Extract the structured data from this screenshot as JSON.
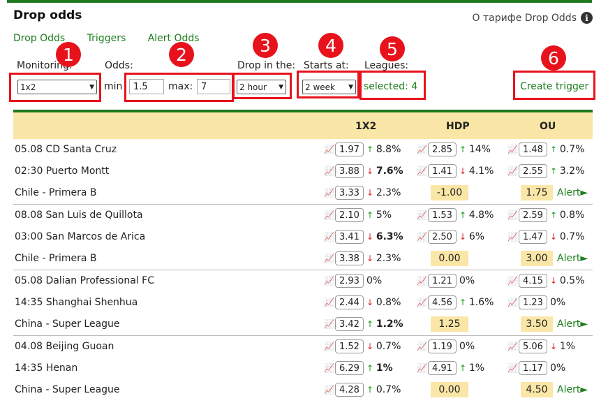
{
  "title": "Drop odds",
  "tariff_link": "О тарифе Drop Odds",
  "nav": [
    "Drop Odds",
    "Triggers",
    "Alert Odds"
  ],
  "filters": {
    "monitoring_label": "Monitoring:",
    "monitoring_value": "1x2",
    "odds_label": "Odds:",
    "min_label": "min",
    "min_value": "1.5",
    "max_label": "max:",
    "max_value": "7",
    "drop_label": "Drop in the:",
    "drop_value": "2 hour",
    "starts_label": "Starts at:",
    "starts_value": "2 week",
    "leagues_label": "Leagues:",
    "leagues_value": "selected: 4",
    "create_trigger": "Create trigger"
  },
  "annotations": [
    "1",
    "2",
    "3",
    "4",
    "5",
    "6"
  ],
  "table": {
    "headers": [
      "1X2",
      "HDP",
      "OU"
    ],
    "matches": [
      {
        "rows": [
          {
            "name": "05.08 CD Santa Cruz",
            "o1": {
              "odd": "1.97",
              "dir": "up",
              "pct": "8.8%",
              "bold": false
            },
            "o2": {
              "odd": "2.85",
              "dir": "up",
              "pct": "14%",
              "bold": false
            },
            "o3": {
              "odd": "1.48",
              "dir": "up",
              "pct": "0.7%",
              "bold": false
            }
          },
          {
            "name": "02:30 Puerto Montt",
            "o1": {
              "odd": "3.88",
              "dir": "down",
              "pct": "7.6%",
              "bold": true
            },
            "o2": {
              "odd": "1.41",
              "dir": "down",
              "pct": "4.1%",
              "bold": false
            },
            "o3": {
              "odd": "2.55",
              "dir": "up",
              "pct": "3.2%",
              "bold": false
            }
          },
          {
            "name": "Chile - Primera B",
            "o1": {
              "odd": "3.33",
              "dir": "down",
              "pct": "2.3%",
              "bold": false
            },
            "hdp_line": "-1.00",
            "ou_line": "1.75",
            "alert": "Alert►"
          }
        ]
      },
      {
        "rows": [
          {
            "name": "08.08 San Luis de Quillota",
            "o1": {
              "odd": "2.10",
              "dir": "up",
              "pct": "5%",
              "bold": false
            },
            "o2": {
              "odd": "1.53",
              "dir": "up",
              "pct": "4.8%",
              "bold": false
            },
            "o3": {
              "odd": "2.59",
              "dir": "up",
              "pct": "0.8%",
              "bold": false
            }
          },
          {
            "name": "03:00 San Marcos de Arica",
            "o1": {
              "odd": "3.41",
              "dir": "down",
              "pct": "6.3%",
              "bold": true
            },
            "o2": {
              "odd": "2.50",
              "dir": "down",
              "pct": "6%",
              "bold": false
            },
            "o3": {
              "odd": "1.47",
              "dir": "down",
              "pct": "0.7%",
              "bold": false
            }
          },
          {
            "name": "Chile - Primera B",
            "o1": {
              "odd": "3.38",
              "dir": "down",
              "pct": "2.3%",
              "bold": false
            },
            "hdp_line": "0.00",
            "ou_line": "3.00",
            "alert": "Alert►"
          }
        ]
      },
      {
        "rows": [
          {
            "name": "05.08 Dalian Professional FC",
            "o1": {
              "odd": "2.93",
              "dir": "",
              "pct": "0%",
              "bold": false
            },
            "o2": {
              "odd": "1.21",
              "dir": "",
              "pct": "0%",
              "bold": false
            },
            "o3": {
              "odd": "4.15",
              "dir": "down",
              "pct": "0.5%",
              "bold": false
            }
          },
          {
            "name": "14:35 Shanghai Shenhua",
            "o1": {
              "odd": "2.44",
              "dir": "down",
              "pct": "0.8%",
              "bold": false
            },
            "o2": {
              "odd": "4.56",
              "dir": "up",
              "pct": "1.6%",
              "bold": false
            },
            "o3": {
              "odd": "1.23",
              "dir": "",
              "pct": "0%",
              "bold": false
            }
          },
          {
            "name": "China - Super League",
            "o1": {
              "odd": "3.42",
              "dir": "up",
              "pct": "1.2%",
              "bold": true
            },
            "hdp_line": "1.25",
            "ou_line": "3.50",
            "alert": "Alert►"
          }
        ]
      },
      {
        "rows": [
          {
            "name": "04.08 Beijing Guoan",
            "o1": {
              "odd": "1.52",
              "dir": "down",
              "pct": "0.7%",
              "bold": false
            },
            "o2": {
              "odd": "1.19",
              "dir": "",
              "pct": "0%",
              "bold": false
            },
            "o3": {
              "odd": "5.06",
              "dir": "down",
              "pct": "1%",
              "bold": false
            }
          },
          {
            "name": "14:35 Henan",
            "o1": {
              "odd": "6.29",
              "dir": "up",
              "pct": "1%",
              "bold": true
            },
            "o2": {
              "odd": "4.91",
              "dir": "up",
              "pct": "1%",
              "bold": false
            },
            "o3": {
              "odd": "1.17",
              "dir": "",
              "pct": "0%",
              "bold": false
            }
          },
          {
            "name": "China - Super League",
            "o1": {
              "odd": "4.28",
              "dir": "up",
              "pct": "0.7%",
              "bold": false
            },
            "hdp_line": "0.00",
            "ou_line": "4.50",
            "alert": "Alert►"
          }
        ]
      }
    ]
  },
  "icons": {
    "chart": "chart-icon",
    "info": "info-icon",
    "up": "arrow-up-icon",
    "down": "arrow-down-icon"
  },
  "colors": {
    "accent_green": "#1e7e1e",
    "highlight": "#fae6a6",
    "annotation_red": "#e8121c",
    "up": "#1a9a1a",
    "down": "#d92020"
  }
}
